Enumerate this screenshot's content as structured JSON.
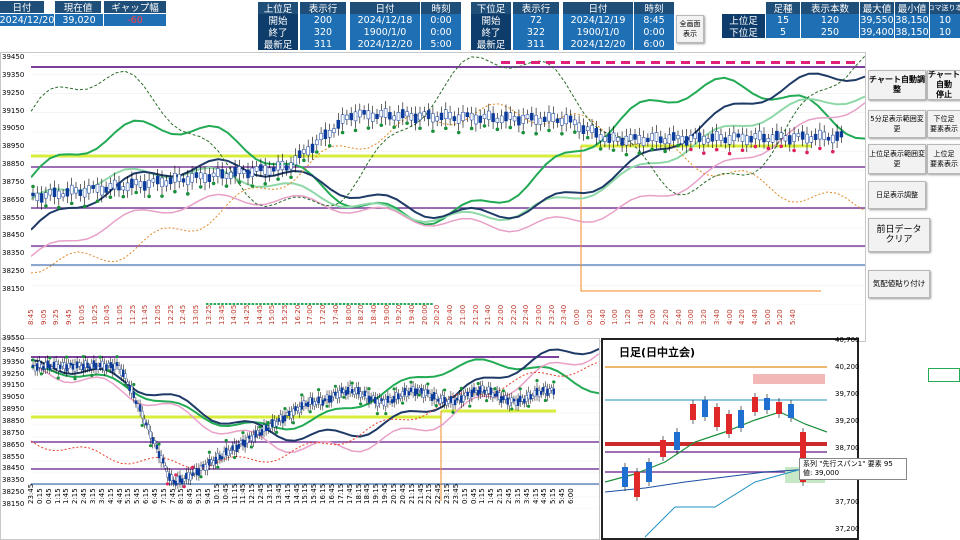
{
  "header_left": {
    "cols": [
      "日付",
      "現在値",
      "ギャップ幅"
    ],
    "vals": [
      "2024/12/20",
      "39,020",
      "-60"
    ]
  },
  "upper_block": {
    "head": [
      "上位足",
      "表示行",
      "日付",
      "時刻"
    ],
    "rows": [
      {
        "label": "開始",
        "row": "200",
        "date": "2024/12/18",
        "time": "0:00"
      },
      {
        "label": "終了",
        "row": "320",
        "date": "1900/1/0",
        "time": "0:00"
      },
      {
        "label": "最新足",
        "row": "311",
        "date": "2024/12/20",
        "time": "5:00"
      }
    ]
  },
  "lower_block": {
    "head": [
      "下位足",
      "表示行",
      "日付",
      "時刻"
    ],
    "rows": [
      {
        "label": "開始",
        "row": "72",
        "date": "2024/12/19",
        "time": "8:45"
      },
      {
        "label": "終了",
        "row": "322",
        "date": "1900/1/0",
        "time": "0:00"
      },
      {
        "label": "最新足",
        "row": "311",
        "date": "2024/12/20",
        "time": "6:00"
      }
    ]
  },
  "fullscreen_button": "全画面\n表示",
  "stats": {
    "head": [
      "足種",
      "表示本数",
      "最大値",
      "最小値",
      "コマ送り本"
    ],
    "rows": [
      {
        "label": "上位足",
        "ashi": "15",
        "count": "120",
        "max": "39,550",
        "min": "38,150",
        "koma": "10"
      },
      {
        "label": "下位足",
        "ashi": "5",
        "count": "250",
        "max": "39,400",
        "min": "38,150",
        "koma": "10"
      }
    ]
  },
  "side_buttons": [
    {
      "text": "チャート自動調整"
    },
    {
      "text": "チャート自動\n停止"
    },
    {
      "text": "5分足表示範囲変更"
    },
    {
      "text": "下位足\n要素表示"
    },
    {
      "text": "上位足表示範囲変更"
    },
    {
      "text": "上位足\n要素表示"
    },
    {
      "text": "日足表示調整"
    },
    {
      "text": "前日データ\nクリア"
    },
    {
      "text": "気配値貼り付け"
    }
  ],
  "upper_chart": {
    "y_ticks": [
      "39450",
      "39350",
      "39250",
      "39150",
      "39050",
      "38950",
      "38850",
      "38750",
      "38650",
      "38550",
      "38450",
      "38350",
      "38250",
      "38150"
    ],
    "x_ticks": [
      "8:45",
      "9:05",
      "9:25",
      "9:45",
      "10:05",
      "10:25",
      "10:45",
      "11:05",
      "11:25",
      "11:45",
      "12:05",
      "12:25",
      "12:45",
      "13:05",
      "13:25",
      "13:45",
      "14:05",
      "14:25",
      "14:45",
      "15:05",
      "15:25",
      "16:20",
      "17:00",
      "17:20",
      "17:40",
      "18:00",
      "18:20",
      "18:40",
      "19:00",
      "19:20",
      "19:40",
      "20:00",
      "20:20",
      "20:40",
      "21:00",
      "21:20",
      "21:40",
      "22:00",
      "22:20",
      "22:40",
      "23:00",
      "23:20",
      "23:40",
      "0:00",
      "0:20",
      "0:40",
      "1:00",
      "1:20",
      "1:40",
      "2:00",
      "2:20",
      "2:40",
      "3:00",
      "3:20",
      "3:40",
      "4:00",
      "4:20",
      "4:40",
      "5:00",
      "5:20",
      "5:40"
    ]
  },
  "lower_chart": {
    "y_ticks": [
      "39550",
      "39450",
      "39350",
      "39250",
      "39150",
      "39050",
      "38950",
      "38850",
      "38750",
      "38650",
      "38550",
      "38450",
      "38350",
      "38250",
      "38150"
    ],
    "x_ticks": [
      "23:45",
      "0:15",
      "0:45",
      "1:15",
      "1:45",
      "2:15",
      "2:45",
      "3:15",
      "3:45",
      "4:15",
      "4:45",
      "5:15",
      "5:45",
      "6:15",
      "6:45",
      "7:15",
      "7:45",
      "8:15",
      "8:45",
      "9:15",
      "9:45",
      "10:15",
      "10:45",
      "11:15",
      "11:45",
      "12:15",
      "12:45",
      "13:15",
      "13:45",
      "14:15",
      "14:45",
      "15:15",
      "15:45",
      "16:15",
      "16:45",
      "17:15",
      "17:45",
      "18:15",
      "18:45",
      "19:15",
      "19:45",
      "20:15",
      "20:45",
      "21:15",
      "21:45",
      "22:15",
      "22:45",
      "23:15",
      "23:45",
      "0:15",
      "0:45",
      "1:15",
      "1:45",
      "2:15",
      "2:45",
      "3:15",
      "3:45",
      "4:15",
      "4:45",
      "5:15",
      "5:45",
      "6:00"
    ]
  },
  "daily_chart": {
    "title": "日足(日中立会)",
    "y_ticks": [
      "40,700",
      "40,200",
      "39,700",
      "39,200",
      "38,700",
      "38,200",
      "37,700",
      "37,200"
    ],
    "tooltip": "系列 \"先行スパン1\" 要素 95\n値: 39,000"
  },
  "colors": {
    "header_dark": "#1f4e79",
    "header_val": "#1f6fb4",
    "line_purple": "#7b3f9e",
    "line_yellow": "#d8ec3c",
    "line_green": "#22aa55",
    "line_navy": "#1e3a66",
    "line_pink": "#e8a0c8",
    "line_orange": "#e08a2a"
  }
}
